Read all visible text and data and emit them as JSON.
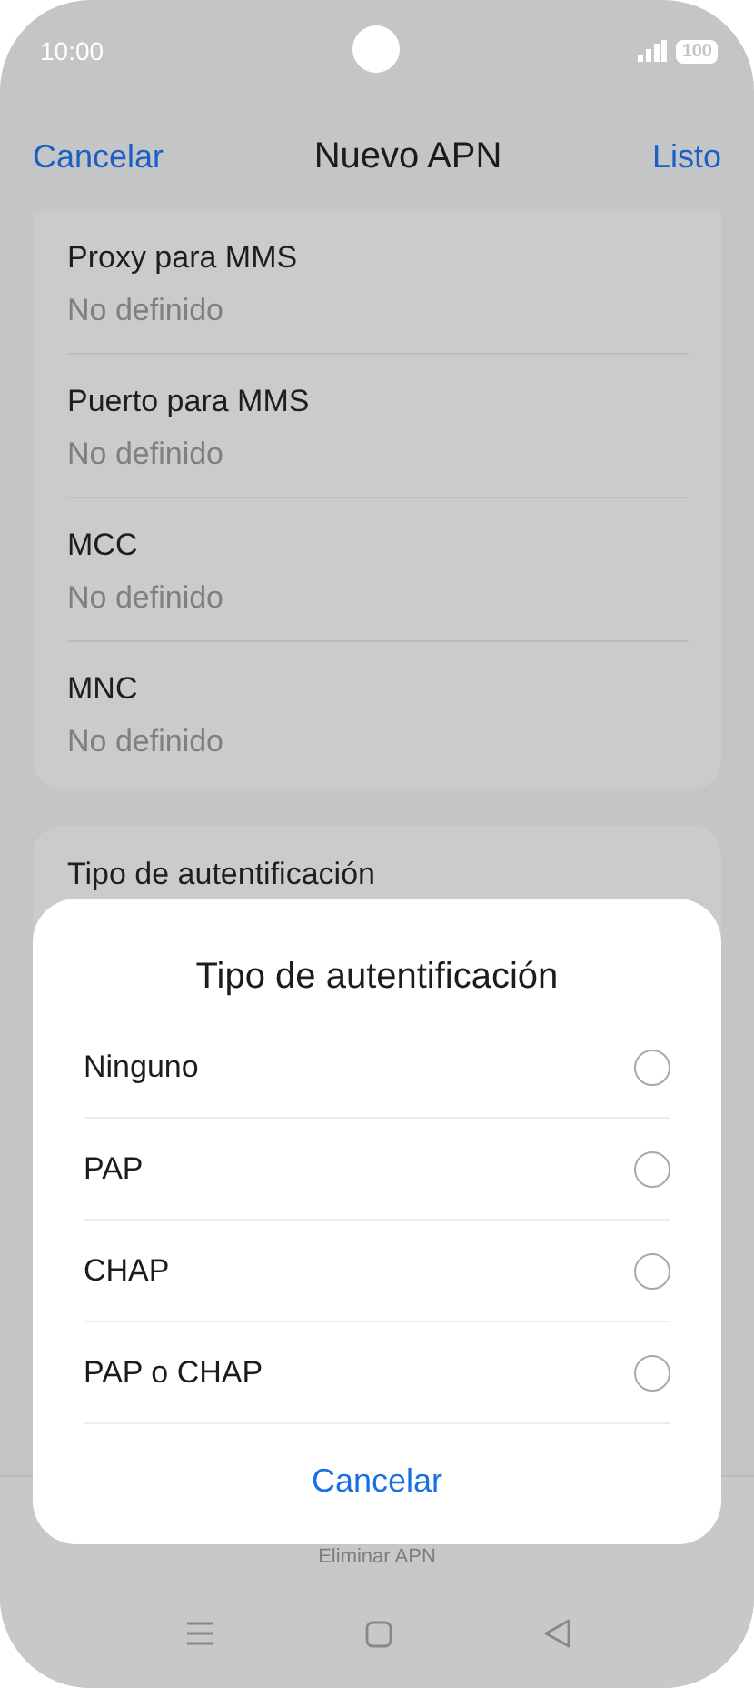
{
  "status_bar": {
    "time": "10:00",
    "battery": "100"
  },
  "header": {
    "cancel": "Cancelar",
    "title": "Nuevo APN",
    "done": "Listo"
  },
  "fields": [
    {
      "label": "Proxy para MMS",
      "value": "No definido"
    },
    {
      "label": "Puerto para MMS",
      "value": "No definido"
    },
    {
      "label": "MCC",
      "value": "No definido"
    },
    {
      "label": "MNC",
      "value": "No definido"
    }
  ],
  "auth_section": {
    "label": "Tipo de autentificación"
  },
  "dialog": {
    "title": "Tipo de autentificación",
    "options": [
      {
        "label": "Ninguno",
        "selected": false
      },
      {
        "label": "PAP",
        "selected": false
      },
      {
        "label": "CHAP",
        "selected": false
      },
      {
        "label": "PAP o CHAP",
        "selected": false
      }
    ],
    "cancel": "Cancelar"
  },
  "footer": {
    "delete": "Eliminar APN"
  }
}
